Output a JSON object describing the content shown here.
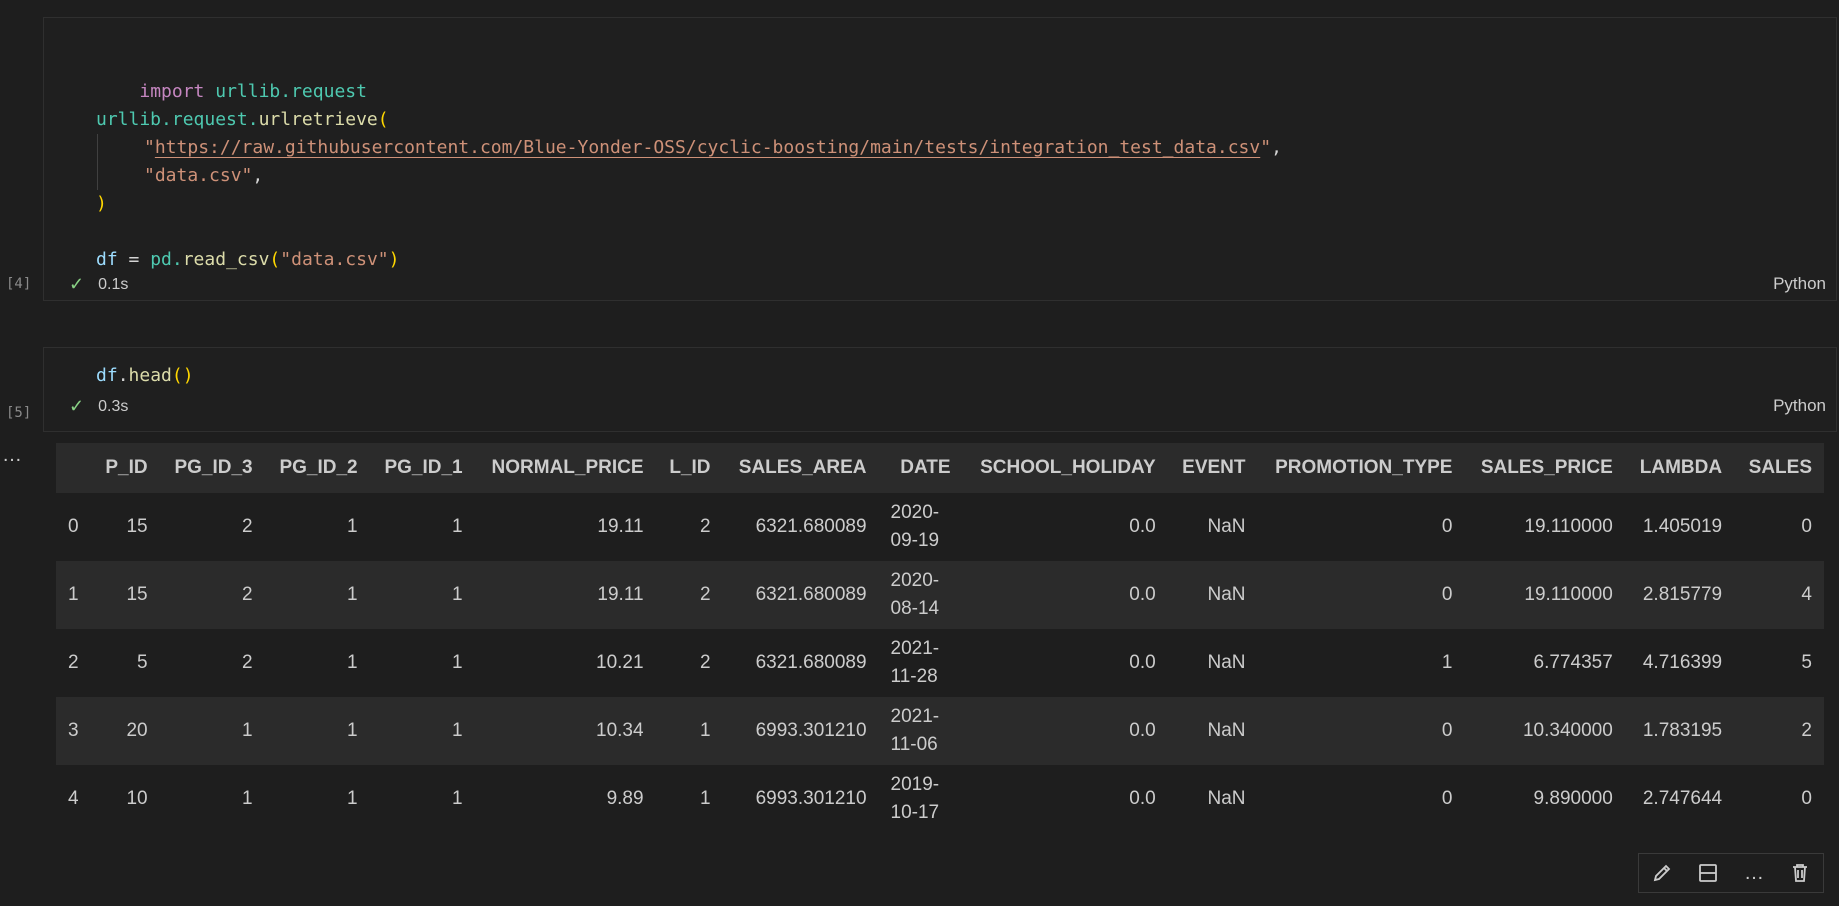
{
  "cell1": {
    "exec_count": "[4]",
    "lines": {
      "l1_kw": "import",
      "l1_mod": "urllib.request",
      "l3_mod": "urllib.request.",
      "l3_fn": "urlretrieve",
      "l3_paren": "(",
      "l4_q1": "\"",
      "l4_url": "https://raw.githubusercontent.com/Blue-Yonder-OSS/cyclic-boosting/main/tests/integration_test_data.csv",
      "l4_q2": "\"",
      "l4_comma": ",",
      "l5_str": "\"data.csv\"",
      "l5_comma": ",",
      "l6_paren": ")",
      "l8_var": "df",
      "l8_eq": " = ",
      "l8_mod": "pd.",
      "l8_fn": "read_csv",
      "l8_p1": "(",
      "l8_str": "\"data.csv\"",
      "l8_p2": ")"
    },
    "status_time": "0.1s",
    "language": "Python"
  },
  "cell2": {
    "exec_count": "[5]",
    "code_var": "df",
    "code_dot": ".",
    "code_fn": "head",
    "code_paren": "()",
    "status_time": "0.3s",
    "language": "Python"
  },
  "output": {
    "more_icon": "ellipsis-icon",
    "table": {
      "columns": [
        "",
        "P_ID",
        "PG_ID_3",
        "PG_ID_2",
        "PG_ID_1",
        "NORMAL_PRICE",
        "L_ID",
        "SALES_AREA",
        "DATE",
        "SCHOOL_HOLIDAY",
        "EVENT",
        "PROMOTION_TYPE",
        "SALES_PRICE",
        "LAMBDA",
        "SALES"
      ],
      "rows": [
        [
          "0",
          "15",
          "2",
          "1",
          "1",
          "19.11",
          "2",
          "6321.680089",
          "2020-\n09-19",
          "0.0",
          "NaN",
          "0",
          "19.110000",
          "1.405019",
          "0"
        ],
        [
          "1",
          "15",
          "2",
          "1",
          "1",
          "19.11",
          "2",
          "6321.680089",
          "2020-\n08-14",
          "0.0",
          "NaN",
          "0",
          "19.110000",
          "2.815779",
          "4"
        ],
        [
          "2",
          "5",
          "2",
          "1",
          "1",
          "10.21",
          "2",
          "6321.680089",
          "2021-\n11-28",
          "0.0",
          "NaN",
          "1",
          "6.774357",
          "4.716399",
          "5"
        ],
        [
          "3",
          "20",
          "1",
          "1",
          "1",
          "10.34",
          "1",
          "6993.301210",
          "2021-\n11-06",
          "0.0",
          "NaN",
          "0",
          "10.340000",
          "1.783195",
          "2"
        ],
        [
          "4",
          "10",
          "1",
          "1",
          "1",
          "9.89",
          "1",
          "6993.301210",
          "2019-\n10-17",
          "0.0",
          "NaN",
          "0",
          "9.890000",
          "2.747644",
          "0"
        ]
      ]
    }
  },
  "toolbar": {
    "icons": [
      "pencil-icon",
      "split-cell-icon",
      "more-actions-icon",
      "trash-icon"
    ]
  }
}
